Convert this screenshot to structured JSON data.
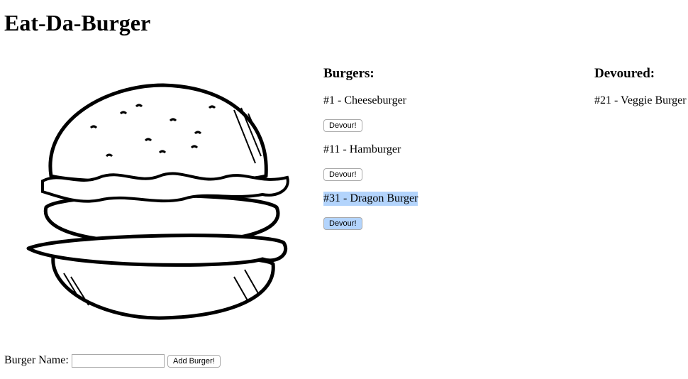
{
  "page": {
    "title": "Eat-Da-Burger"
  },
  "burgers": {
    "heading": "Burgers:",
    "items": [
      {
        "label": "#1 - Cheeseburger",
        "button": "Devour!"
      },
      {
        "label": "#11 - Hamburger",
        "button": "Devour!"
      },
      {
        "label": "#31 - Dragon Burger",
        "button": "Devour!"
      }
    ]
  },
  "devoured": {
    "heading": "Devoured:",
    "items": [
      {
        "label": "#21 - Veggie Burger"
      }
    ]
  },
  "form": {
    "label": "Burger Name:",
    "input_value": "",
    "submit_label": "Add Burger!"
  }
}
